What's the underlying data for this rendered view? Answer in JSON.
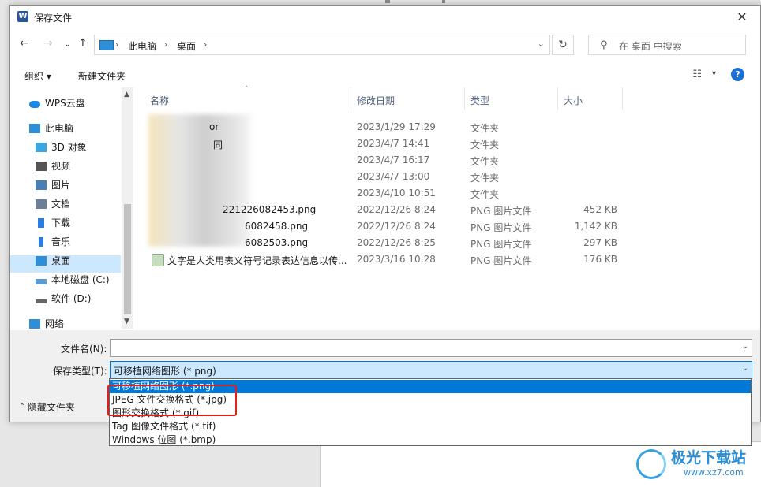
{
  "window": {
    "title": "保存文件",
    "app_icon_letter": "W",
    "close_glyph": "✕"
  },
  "nav": {
    "back": "←",
    "forward": "→",
    "recent": "⌄",
    "up": "↑",
    "breadcrumbs": [
      "此电脑",
      "桌面"
    ],
    "separator": "›",
    "dropdown": "⌄",
    "refresh": "↻",
    "search_icon": "⚲",
    "search_placeholder": "在 桌面 中搜索"
  },
  "toolbar": {
    "organize": "组织 ▾",
    "new_folder": "新建文件夹",
    "view_icon": "☷",
    "view_dropdown": "▾",
    "help": "?"
  },
  "sidebar": {
    "items": [
      {
        "label": "WPS云盘",
        "icon": "cloud-icon",
        "color": "#1e88e5"
      },
      {
        "label": "此电脑",
        "icon": "computer-icon",
        "color": "#2f8ed8"
      },
      {
        "label": "3D 对象",
        "icon": "cube-icon",
        "color": "#3aa7e0"
      },
      {
        "label": "视频",
        "icon": "film-icon",
        "color": "#555555"
      },
      {
        "label": "图片",
        "icon": "picture-icon",
        "color": "#4a7fb5"
      },
      {
        "label": "文档",
        "icon": "document-icon",
        "color": "#6b7f99"
      },
      {
        "label": "下载",
        "icon": "download-arrow-icon",
        "color": "#2a7de1"
      },
      {
        "label": "音乐",
        "icon": "music-note-icon",
        "color": "#2a7de1"
      },
      {
        "label": "桌面",
        "icon": "desktop-icon",
        "color": "#2f8ed8"
      },
      {
        "label": "本地磁盘 (C:)",
        "icon": "drive-c-icon",
        "color": "#5a9bd5"
      },
      {
        "label": "软件 (D:)",
        "icon": "drive-d-icon",
        "color": "#666666"
      },
      {
        "label": "网络",
        "icon": "network-icon",
        "color": "#2f8ed8"
      }
    ],
    "selected": "桌面",
    "scroll_up": "▲",
    "scroll_down": "▼"
  },
  "columns": {
    "name": "名称",
    "date": "修改日期",
    "type": "类型",
    "size": "大小",
    "sort_indicator": "˄"
  },
  "files": [
    {
      "name": "or",
      "date": "2023/1/29 17:29",
      "type": "文件夹",
      "size": ""
    },
    {
      "name": "同",
      "date": "2023/4/7 14:41",
      "type": "文件夹",
      "size": ""
    },
    {
      "name": "",
      "date": "2023/4/7 16:17",
      "type": "文件夹",
      "size": ""
    },
    {
      "name": "",
      "date": "2023/4/7 13:00",
      "type": "文件夹",
      "size": ""
    },
    {
      "name": "",
      "date": "2023/4/10 10:51",
      "type": "文件夹",
      "size": ""
    },
    {
      "name": "221226082453.png",
      "date": "2022/12/26 8:24",
      "type": "PNG 图片文件",
      "size": "452 KB"
    },
    {
      "name": "6082458.png",
      "date": "2022/12/26 8:24",
      "type": "PNG 图片文件",
      "size": "1,142 KB"
    },
    {
      "name": "6082503.png",
      "date": "2022/12/26 8:25",
      "type": "PNG 图片文件",
      "size": "297 KB"
    },
    {
      "name": "文字是人类用表义符号记录表达信息以传...",
      "date": "2023/3/16 10:28",
      "type": "PNG 图片文件",
      "size": "176 KB"
    }
  ],
  "bottom": {
    "filename_label": "文件名(N):",
    "filename_value": "",
    "filetype_label": "保存类型(T):",
    "filetype_value": "可移植网络图形 (*.png)",
    "combo_arrow": "⌄",
    "hide_folders": "˄  隐藏文件夹"
  },
  "dropdown_options": [
    "可移植网络图形 (*.png)",
    "JPEG 文件交换格式 (*.jpg)",
    "图形交换格式 (*.gif)",
    "Tag 图像文件格式 (*.tif)",
    "Windows 位图 (*.bmp)"
  ],
  "dropdown_selected_index": 0,
  "watermark": {
    "brand": "极光下载站",
    "url": "www.xz7.com"
  },
  "colors": {
    "selection": "#cce8ff",
    "accent": "#0078d7",
    "highlight_box": "#e02020"
  }
}
